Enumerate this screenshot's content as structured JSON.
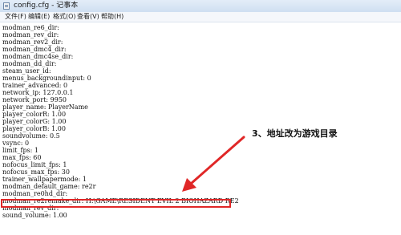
{
  "window": {
    "title": "config.cfg - 记事本"
  },
  "menu": {
    "items": [
      "文件(F)",
      "编辑(E)",
      "格式(O)",
      "查看(V)",
      "帮助(H)"
    ]
  },
  "editor": {
    "lines": [
      "modman_re6_dir:",
      "modman_rev_dir:",
      "modman_rev2_dir:",
      "modman_dmc4_dir:",
      "modman_dmc4se_dir:",
      "modman_dd_dir:",
      "steam_user_id:",
      "menus_backgroundinput: 0",
      "trainer_advanced: 0",
      "network_ip: 127.0.0.1",
      "network_port: 9950",
      "player_name: PlayerName",
      "player_colorR: 1.00",
      "player_colorG: 1.00",
      "player_colorB: 1.00",
      "soundvolume: 0.5",
      "vsync: 0",
      "limit_fps: 1",
      "max_fps: 60",
      "nofocus_limit_fps: 1",
      "nofocus_max_fps: 30",
      "trainer_wallpapermode: 1",
      "modman_default_game: re2r",
      "modman_re0hd_dir:",
      "modman_re2remake_dir: H:\\GAME\\RESIDENT EVIL 2  BIOHAZARD RE2",
      "modman_rev_dir:",
      "sound_volume: 1.00"
    ],
    "highlight_color": "#e02727"
  },
  "annotation": {
    "text": "3、地址改为游戏目录",
    "arrow_color": "#e02727"
  }
}
